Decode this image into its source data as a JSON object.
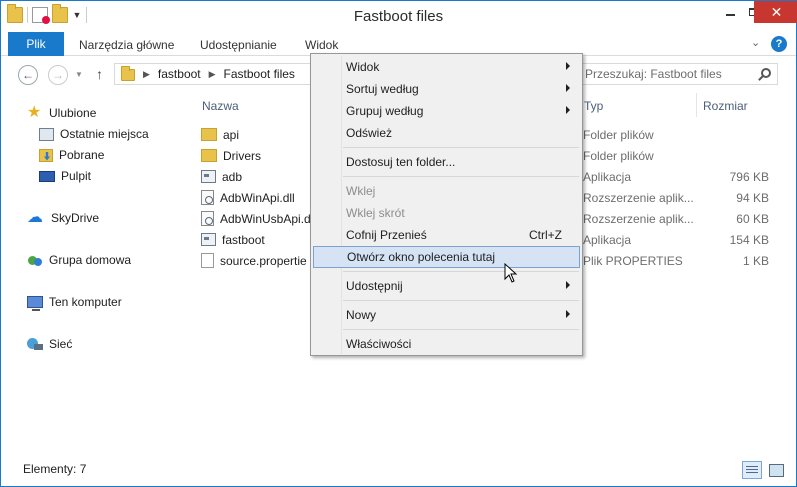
{
  "window": {
    "title": "Fastboot files"
  },
  "ribbon": {
    "file_tab": "Plik",
    "tabs": [
      "Narzędzia główne",
      "Udostępnianie",
      "Widok"
    ]
  },
  "address": {
    "crumbs": [
      "fastboot",
      "Fastboot files"
    ]
  },
  "search": {
    "placeholder": "Przeszukaj: Fastboot files"
  },
  "nav_pane": {
    "favorites": "Ulubione",
    "recent": "Ostatnie miejsca",
    "downloads": "Pobrane",
    "desktop": "Pulpit",
    "skydrive": "SkyDrive",
    "homegroup": "Grupa domowa",
    "computer": "Ten komputer",
    "network": "Sieć"
  },
  "columns": {
    "name": "Nazwa",
    "type": "Typ",
    "size": "Rozmiar"
  },
  "files": [
    {
      "name": "api",
      "type": "Folder plików",
      "size": "",
      "icon": "folder-icon"
    },
    {
      "name": "Drivers",
      "type": "Folder plików",
      "size": "",
      "icon": "folder-icon"
    },
    {
      "name": "adb",
      "type": "Aplikacja",
      "size": "796 KB",
      "icon": "exe-icon"
    },
    {
      "name": "AdbWinApi.dll",
      "type": "Rozszerzenie aplik...",
      "size": "94 KB",
      "icon": "dll-icon"
    },
    {
      "name": "AdbWinUsbApi.d",
      "type": "Rozszerzenie aplik...",
      "size": "60 KB",
      "icon": "dll-icon"
    },
    {
      "name": "fastboot",
      "type": "Aplikacja",
      "size": "154 KB",
      "icon": "exe-icon"
    },
    {
      "name": "source.propertie",
      "type": "Plik PROPERTIES",
      "size": "1 KB",
      "icon": "document-icon"
    }
  ],
  "status": {
    "item_count": "Elementy: 7"
  },
  "context_menu": {
    "view": "Widok",
    "sort_by": "Sortuj według",
    "group_by": "Grupuj według",
    "refresh": "Odśwież",
    "customize": "Dostosuj ten folder...",
    "paste": "Wklej",
    "paste_shortcut": "Wklej skrót",
    "undo_move": "Cofnij Przenieś",
    "undo_shortcut": "Ctrl+Z",
    "open_cmd": "Otwórz okno polecenia tutaj",
    "share_with": "Udostępnij",
    "new": "Nowy",
    "properties": "Właściwości"
  },
  "colors": {
    "accent": "#1979ca",
    "close": "#c7372f",
    "menu_highlight": "#d5e3f5"
  }
}
